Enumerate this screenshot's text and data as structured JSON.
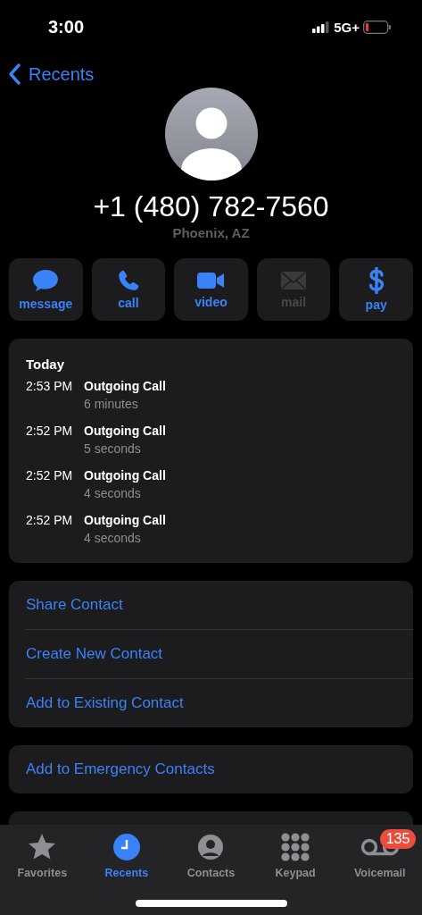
{
  "status_bar": {
    "time": "3:00",
    "network": "5G+"
  },
  "nav": {
    "back_label": "Recents"
  },
  "contact": {
    "number": "+1 (480) 782-7560",
    "location": "Phoenix, AZ"
  },
  "actions": [
    {
      "kind": "message",
      "label": "message",
      "disabled": false
    },
    {
      "kind": "call",
      "label": "call",
      "disabled": false
    },
    {
      "kind": "video",
      "label": "video",
      "disabled": false
    },
    {
      "kind": "mail",
      "label": "mail",
      "disabled": true
    },
    {
      "kind": "pay",
      "label": "pay",
      "disabled": false
    }
  ],
  "call_history": {
    "heading": "Today",
    "calls": [
      {
        "time": "2:53 PM",
        "type": "Outgoing Call",
        "duration": "6 minutes"
      },
      {
        "time": "2:52 PM",
        "type": "Outgoing Call",
        "duration": "5 seconds"
      },
      {
        "time": "2:52 PM",
        "type": "Outgoing Call",
        "duration": "4 seconds"
      },
      {
        "time": "2:52 PM",
        "type": "Outgoing Call",
        "duration": "4 seconds"
      }
    ]
  },
  "contact_options": [
    "Share Contact",
    "Create New Contact",
    "Add to Existing Contact"
  ],
  "emergency_option": "Add to Emergency Contacts",
  "tab_bar": [
    {
      "kind": "favorites",
      "label": "Favorites",
      "selected": false
    },
    {
      "kind": "recents",
      "label": "Recents",
      "selected": true
    },
    {
      "kind": "contacts",
      "label": "Contacts",
      "selected": false
    },
    {
      "kind": "keypad",
      "label": "Keypad",
      "selected": false
    },
    {
      "kind": "voicemail",
      "label": "Voicemail",
      "selected": false,
      "badge": "135"
    }
  ]
}
